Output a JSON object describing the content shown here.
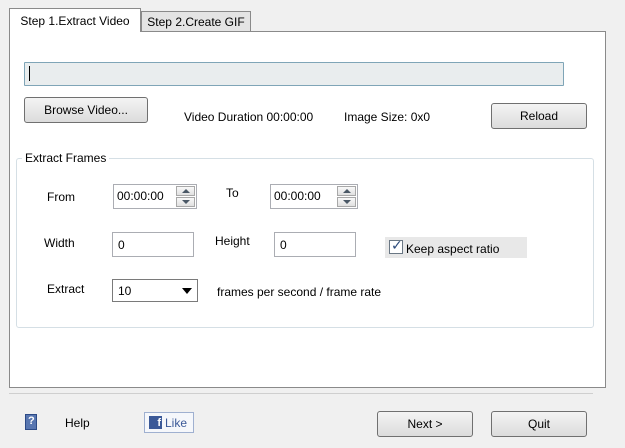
{
  "tabs": [
    {
      "label": "Step 1.Extract Video"
    },
    {
      "label": "Step 2.Create GIF"
    }
  ],
  "video": {
    "path_value": "",
    "browse_label": "Browse Video...",
    "duration_text": "Video Duration 00:00:00",
    "image_size_text": "Image Size: 0x0",
    "reload_label": "Reload"
  },
  "extract": {
    "group_title": "Extract Frames",
    "from_label": "From",
    "from_value": "00:00:00",
    "to_label": "To",
    "to_value": "00:00:00",
    "width_label": "Width",
    "width_value": "0",
    "height_label": "Height",
    "height_value": "0",
    "keep_aspect_label": "Keep aspect ratio",
    "keep_aspect_checked": true,
    "extract_label": "Extract",
    "fps_value": "10",
    "fps_suffix": "frames per second / frame rate"
  },
  "footer": {
    "help_label": "Help",
    "like_label": "Like",
    "next_label": "Next >",
    "quit_label": "Quit"
  },
  "colors": {
    "facebook": "#3b5998",
    "input_border": "#7fa5b7"
  }
}
